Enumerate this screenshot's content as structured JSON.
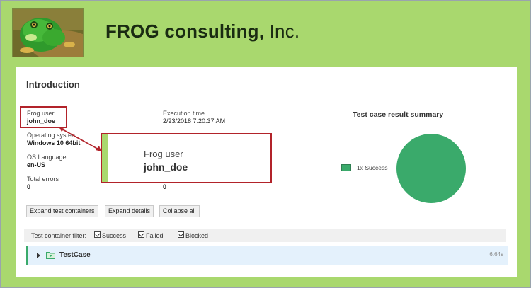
{
  "header": {
    "brand_bold": "FROG consulting,",
    "brand_rest": " Inc."
  },
  "intro": {
    "title": "Introduction",
    "frog_user_label": "Frog user",
    "frog_user_value": "john_doe",
    "os_label": "Operating system",
    "os_value": "Windows 10 64bit",
    "lang_label": "OS Language",
    "lang_value": "en-US",
    "errors_label": "Total errors",
    "errors_value": "0",
    "exec_time_label": "Execution time",
    "exec_time_value": "2/23/2018 7:20:37 AM",
    "second_col_value": "0"
  },
  "callout": {
    "label": "Frog user",
    "value": "john_doe"
  },
  "summary": {
    "title": "Test case result summary",
    "legend_label": "1x Success",
    "colors": {
      "success": "#3aaa6b"
    }
  },
  "chart_data": {
    "type": "pie",
    "categories": [
      "Success"
    ],
    "values": [
      1
    ]
  },
  "buttons": {
    "expand_containers": "Expand test containers",
    "expand_details": "Expand details",
    "collapse_all": "Collapse all"
  },
  "filter": {
    "label": "Test container filter:",
    "success": "Success",
    "failed": "Failed",
    "blocked": "Blocked"
  },
  "testcase": {
    "name": "TestCase",
    "duration": "6.64s"
  }
}
